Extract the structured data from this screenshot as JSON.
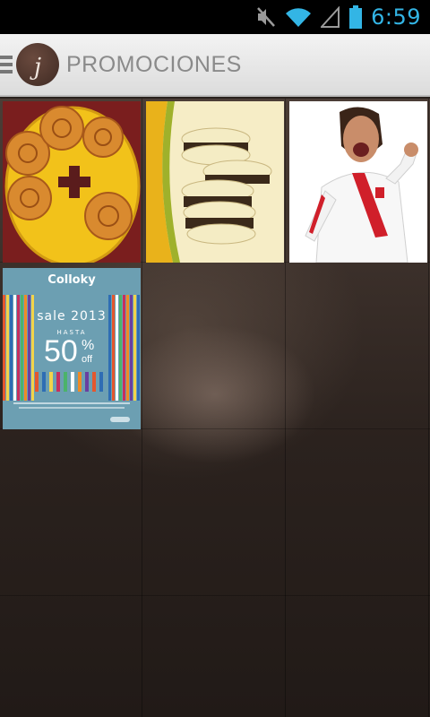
{
  "status_bar": {
    "time": "6:59",
    "icons": [
      "mute-icon",
      "wifi-icon",
      "signal-icon",
      "battery-icon"
    ],
    "accent_color": "#33b5e5"
  },
  "action_bar": {
    "logo_letter": "j",
    "title": "PROMOCIONES",
    "icons": [
      "menu-icon"
    ]
  },
  "promotions": [
    {
      "image": "cinnamon rolls promo"
    },
    {
      "image": "alfajores cookies promo"
    },
    {
      "image": "man in Peru jersey cheering"
    },
    {
      "image": "Colloky sale banner",
      "brand": "Colloky",
      "headline": "sale 2013",
      "hasta": "HASTA",
      "discount": "50",
      "percent": "%",
      "off": "off"
    }
  ]
}
